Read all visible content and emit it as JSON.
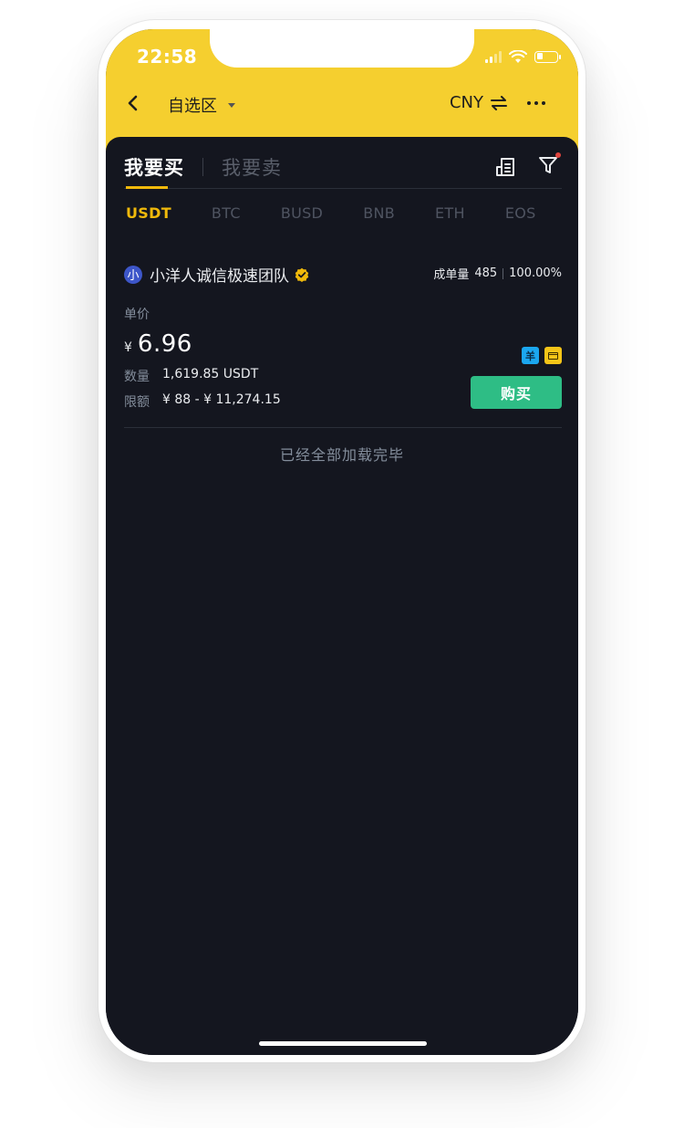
{
  "status_bar": {
    "time": "22:58"
  },
  "nav": {
    "title": "自选区",
    "currency": "CNY"
  },
  "side_tabs": [
    {
      "label": "我要买",
      "active": true
    },
    {
      "label": "我要卖",
      "active": false
    }
  ],
  "coin_tabs": [
    {
      "label": "USDT",
      "active": true
    },
    {
      "label": "BTC",
      "active": false
    },
    {
      "label": "BUSD",
      "active": false
    },
    {
      "label": "BNB",
      "active": false
    },
    {
      "label": "ETH",
      "active": false
    },
    {
      "label": "EOS",
      "active": false
    }
  ],
  "ad": {
    "avatar_char": "小",
    "merchant_name": "小洋人诚信极速团队",
    "orders_label": "成单量",
    "orders_count": "485",
    "completion_rate": "100.00%",
    "price_label": "单价",
    "currency_symbol": "¥",
    "price": "6.96",
    "quantity_label": "数量",
    "quantity_value": "1,619.85 USDT",
    "limit_label": "限额",
    "limit_value": "¥ 88 - ¥ 11,274.15",
    "pay_wechat_char": "羊",
    "buy_label": "购买"
  },
  "list_end_text": "已经全部加载完毕",
  "colors": {
    "header_yellow": "#f5cf2f",
    "background": "#14161f",
    "accent": "#f0b90b",
    "buy_green": "#2ebd85"
  }
}
